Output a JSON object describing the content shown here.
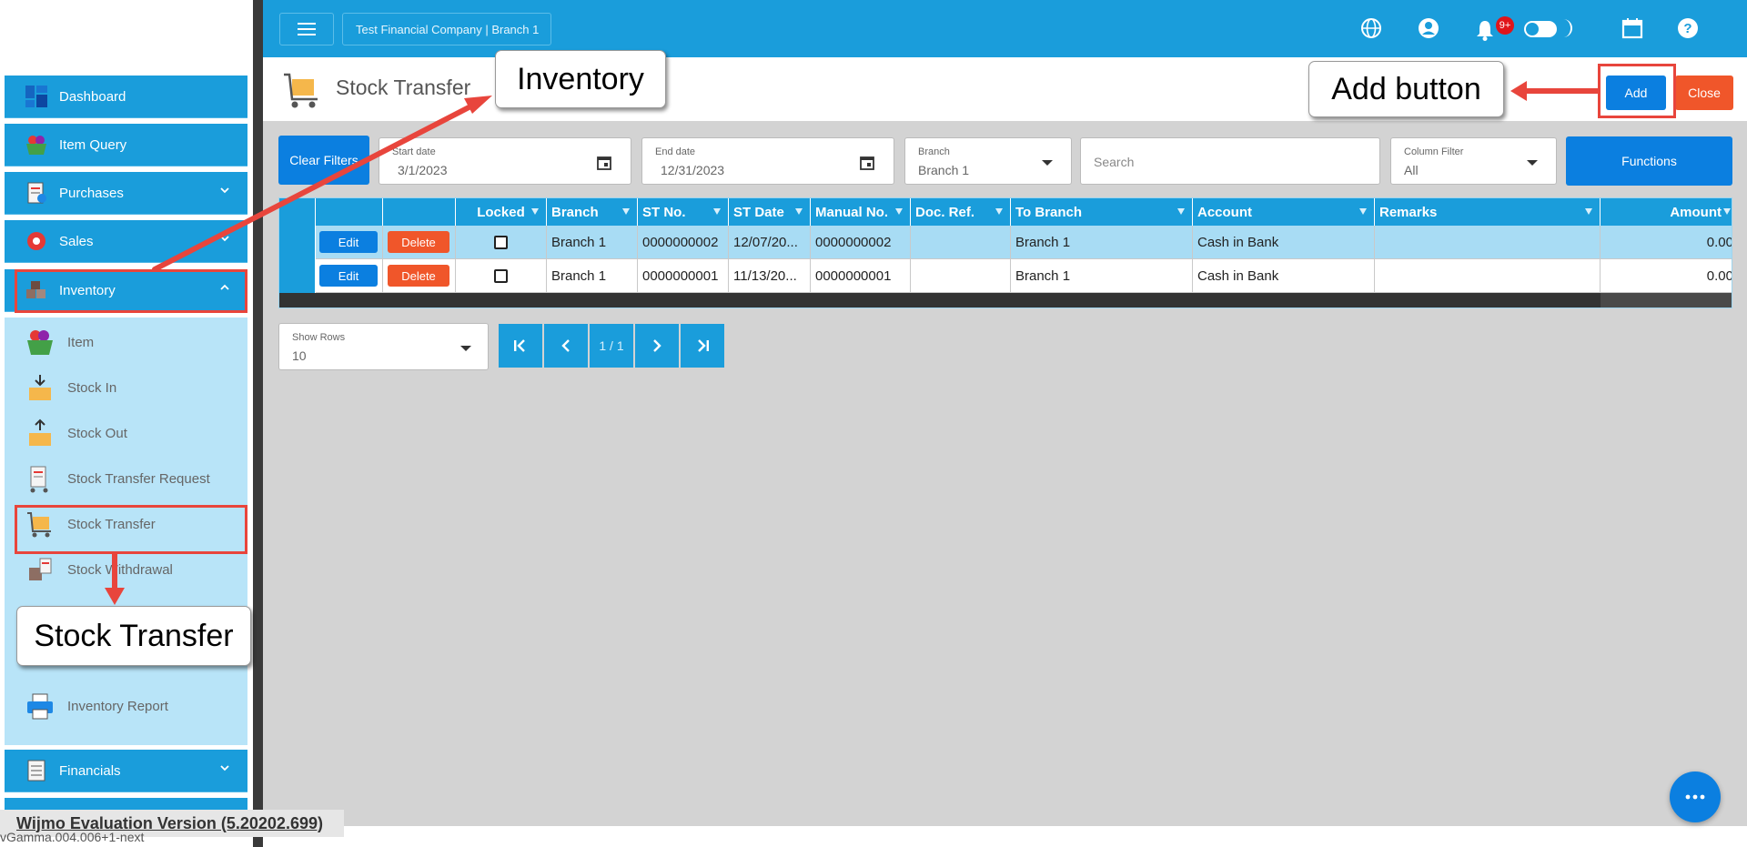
{
  "sidebar": {
    "items": [
      {
        "label": "Dashboard",
        "icon": "dashboard-icon"
      },
      {
        "label": "Item Query",
        "icon": "basket-icon"
      },
      {
        "label": "Purchases",
        "icon": "invoice-icon"
      },
      {
        "label": "Sales",
        "icon": "sale-tag-icon"
      },
      {
        "label": "Inventory",
        "icon": "boxes-icon"
      }
    ],
    "inventory_sub": [
      {
        "label": "Item",
        "icon": "basket-icon"
      },
      {
        "label": "Stock In",
        "icon": "box-in-icon"
      },
      {
        "label": "Stock Out",
        "icon": "box-out-icon"
      },
      {
        "label": "Stock Transfer Request",
        "icon": "trolley-icon"
      },
      {
        "label": "Stock Transfer",
        "icon": "cart-box-icon"
      },
      {
        "label": "Stock Withdrawal",
        "icon": "withdraw-box-icon"
      },
      {
        "label": "Inventory Report",
        "icon": "printer-icon"
      }
    ],
    "financials": {
      "label": "Financials",
      "icon": "ledger-icon"
    }
  },
  "topbar": {
    "company": "Test Financial Company | Branch 1",
    "notif_badge": "9+"
  },
  "page": {
    "title": "Stock Transfer",
    "add_label": "Add",
    "close_label": "Close"
  },
  "filters": {
    "clear_label": "Clear Filters",
    "start_date_label": "Start date",
    "start_date": "3/1/2023",
    "end_date_label": "End date",
    "end_date": "12/31/2023",
    "branch_label": "Branch",
    "branch": "Branch 1",
    "search_placeholder": "Search",
    "column_filter_label": "Column Filter",
    "column_filter": "All",
    "functions_label": "Functions"
  },
  "grid": {
    "columns": [
      "Locked",
      "Branch",
      "ST No.",
      "ST Date",
      "Manual No.",
      "Doc. Ref.",
      "To Branch",
      "Account",
      "Remarks",
      "Amount"
    ],
    "edit_label": "Edit",
    "delete_label": "Delete",
    "rows": [
      {
        "branch": "Branch 1",
        "st_no": "0000000002",
        "st_date": "12/07/20...",
        "manual_no": "0000000002",
        "doc_ref": "",
        "to_branch": "Branch 1",
        "account": "Cash in Bank",
        "remarks": "",
        "amount": "0.00"
      },
      {
        "branch": "Branch 1",
        "st_no": "0000000001",
        "st_date": "11/13/20...",
        "manual_no": "0000000001",
        "doc_ref": "",
        "to_branch": "Branch 1",
        "account": "Cash in Bank",
        "remarks": "",
        "amount": "0.00"
      }
    ]
  },
  "pager": {
    "rows_label": "Show Rows",
    "rows_value": "10",
    "info": "1 / 1"
  },
  "footer": {
    "wijmo": "Wijmo Evaluation Version (5.20202.699)",
    "version": "vGamma.004.006+1-next"
  },
  "annotations": {
    "inventory": "Inventory",
    "add_button": "Add button",
    "stock_transfer": "Stock Transfer",
    "color": "#e8453c"
  },
  "colors": {
    "primary": "#1a9ddb",
    "button_blue": "#0b7fe0",
    "danger": "#f0562a",
    "submenu_bg": "#b8e4f8"
  }
}
